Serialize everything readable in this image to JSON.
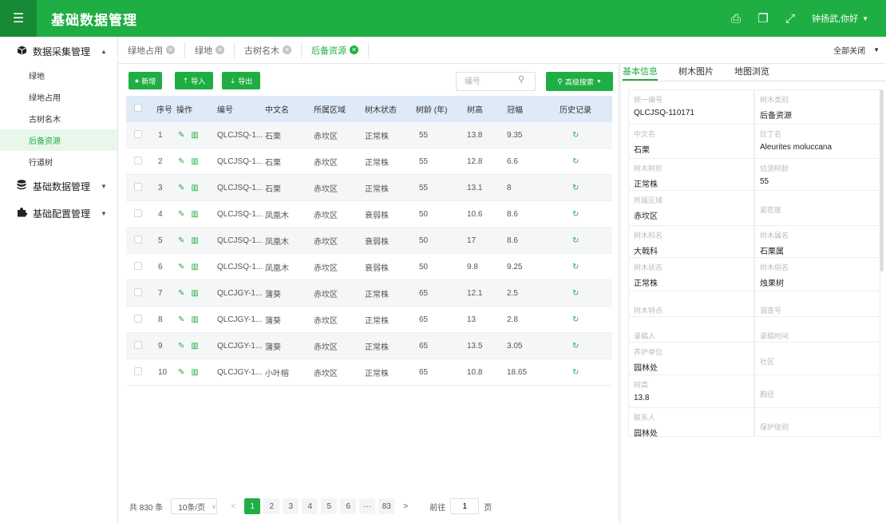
{
  "header": {
    "menu_icon": "hamburger-icon",
    "title": "基础数据管理",
    "icons": [
      "print-icon",
      "copy-icon",
      "fullscreen-icon"
    ],
    "user": "钟扬武,你好"
  },
  "sidebar": {
    "groups": [
      {
        "label": "数据采集管理",
        "icon": "box-icon",
        "expanded": true,
        "items": [
          "绿地",
          "绿地占用",
          "古树名木",
          "后备资源",
          "行道树"
        ]
      },
      {
        "label": "基础数据管理",
        "icon": "database-icon",
        "expanded": false
      },
      {
        "label": "基础配置管理",
        "icon": "puzzle-icon",
        "expanded": false
      }
    ],
    "active_item": "后备资源"
  },
  "tabs": {
    "items": [
      {
        "label": "绿地占用"
      },
      {
        "label": "绿地"
      },
      {
        "label": "古树名木"
      },
      {
        "label": "后备资源"
      }
    ],
    "active": "后备资源",
    "close_all": "全部关闭"
  },
  "toolbar": {
    "add": "新增",
    "import": "导入",
    "export": "导出",
    "search_placeholder": "编号",
    "advanced_search": "高级搜索"
  },
  "table": {
    "columns": [
      "序号",
      "操作",
      "编号",
      "中文名",
      "所属区域",
      "树木状态",
      "树龄 (年)",
      "树高",
      "冠幅",
      "历史记录"
    ],
    "rows": [
      {
        "no": "1",
        "code": "QLCJSQ-1...",
        "name": "石栗",
        "area": "赤坎区",
        "status": "正常株",
        "age": "55",
        "height": "13.8",
        "crown": "9.35"
      },
      {
        "no": "2",
        "code": "QLCJSQ-1...",
        "name": "石栗",
        "area": "赤坎区",
        "status": "正常株",
        "age": "55",
        "height": "12.8",
        "crown": "6.6"
      },
      {
        "no": "3",
        "code": "QLCJSQ-1...",
        "name": "石栗",
        "area": "赤坎区",
        "status": "正常株",
        "age": "55",
        "height": "13.1",
        "crown": "8"
      },
      {
        "no": "4",
        "code": "QLCJSQ-1...",
        "name": "凤凰木",
        "area": "赤坎区",
        "status": "衰弱株",
        "age": "50",
        "height": "10.6",
        "crown": "8.6"
      },
      {
        "no": "5",
        "code": "QLCJSQ-1...",
        "name": "凤凰木",
        "area": "赤坎区",
        "status": "衰弱株",
        "age": "50",
        "height": "17",
        "crown": "8.6"
      },
      {
        "no": "6",
        "code": "QLCJSQ-1...",
        "name": "凤凰木",
        "area": "赤坎区",
        "status": "衰弱株",
        "age": "50",
        "height": "9.8",
        "crown": "9.25"
      },
      {
        "no": "7",
        "code": "QLCJGY-1...",
        "name": "蒲葵",
        "area": "赤坎区",
        "status": "正常株",
        "age": "65",
        "height": "12.1",
        "crown": "2.5"
      },
      {
        "no": "8",
        "code": "QLCJGY-1...",
        "name": "蒲葵",
        "area": "赤坎区",
        "status": "正常株",
        "age": "65",
        "height": "13",
        "crown": "2.8"
      },
      {
        "no": "9",
        "code": "QLCJGY-1...",
        "name": "蒲葵",
        "area": "赤坎区",
        "status": "正常株",
        "age": "65",
        "height": "13.5",
        "crown": "3.05"
      },
      {
        "no": "10",
        "code": "QLCJGY-1...",
        "name": "小叶榕",
        "area": "赤坎区",
        "status": "正常株",
        "age": "65",
        "height": "10.8",
        "crown": "18.65"
      }
    ]
  },
  "pagination": {
    "total": "共 830 条",
    "page_size": "10条/页",
    "pages": [
      "1",
      "2",
      "3",
      "4",
      "5",
      "6",
      "···",
      "83"
    ],
    "current": "1",
    "goto_label": "前往",
    "goto_value": "1",
    "page_unit": "页"
  },
  "detail": {
    "tabs": [
      "基本信息",
      "树木图片",
      "地图浏览"
    ],
    "active_tab": "基本信息",
    "fields": [
      {
        "label": "统一编号",
        "value": "QLCJSQ-110171"
      },
      {
        "label": "树木类别",
        "value": "后备资源"
      },
      {
        "label": "中文名",
        "value": "石栗"
      },
      {
        "label": "拉丁名",
        "value": "Aleurites moluccana"
      },
      {
        "label": "树木树形",
        "value": "正常株"
      },
      {
        "label": "估测树龄",
        "value": "55"
      },
      {
        "label": "所属区域",
        "value": "赤坎区"
      },
      {
        "label": "紧密度",
        "value": ""
      },
      {
        "label": "树木科名",
        "value": "大戟科"
      },
      {
        "label": "树木属名",
        "value": "石栗属"
      },
      {
        "label": "树木状态",
        "value": "正常株"
      },
      {
        "label": "树木俗名",
        "value": "烛果树"
      },
      {
        "label": "树木特点",
        "value": ""
      },
      {
        "label": "调查号",
        "value": ""
      },
      {
        "label": "录稿人",
        "value": ""
      },
      {
        "label": "录稿时间",
        "value": ""
      },
      {
        "label": "养护单位",
        "value": "园林处"
      },
      {
        "label": "社区",
        "value": ""
      },
      {
        "label": "树高",
        "value": "13.8"
      },
      {
        "label": "胸径",
        "value": ""
      },
      {
        "label": "联系人",
        "value": "园林处"
      },
      {
        "label": "保护级别",
        "value": ""
      }
    ]
  },
  "colors": {
    "brand": "#1fae43",
    "header_dark": "#178a35",
    "table_header": "#dfeaf8"
  }
}
